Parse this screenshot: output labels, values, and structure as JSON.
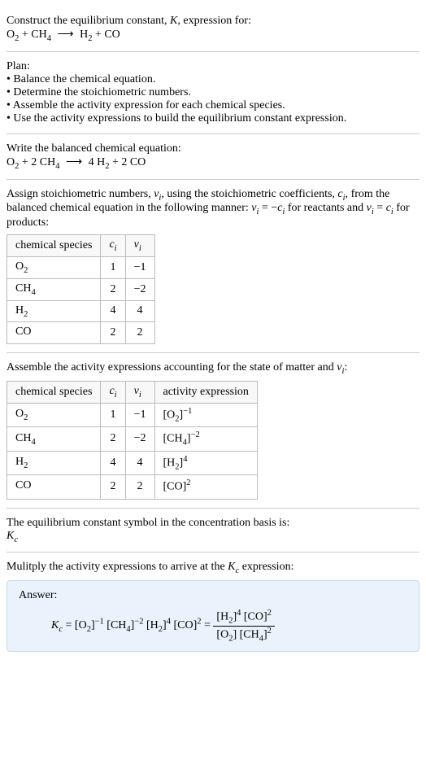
{
  "intro": {
    "title_prefix": "Construct the equilibrium constant, ",
    "title_symbol": "K",
    "title_suffix": ", expression for:",
    "equation_lhs1": "O",
    "equation_lhs1_sub": "2",
    "equation_plus": " + ",
    "equation_lhs2": "CH",
    "equation_lhs2_sub": "4",
    "arrow": "⟶",
    "equation_rhs1": "H",
    "equation_rhs1_sub": "2",
    "equation_rhs2": "CO"
  },
  "plan": {
    "title": "Plan:",
    "items": [
      "Balance the chemical equation.",
      "Determine the stoichiometric numbers.",
      "Assemble the activity expression for each chemical species.",
      "Use the activity expressions to build the equilibrium constant expression."
    ]
  },
  "balanced": {
    "title": "Write the balanced chemical equation:",
    "lhs1": "O",
    "lhs1_sub": "2",
    "plus1": " + 2 ",
    "lhs2": "CH",
    "lhs2_sub": "4",
    "arrow": "⟶",
    "rhs1_coef": " 4 ",
    "rhs1": "H",
    "rhs1_sub": "2",
    "plus2": " + 2 ",
    "rhs2": "CO"
  },
  "stoich": {
    "intro_prefix": "Assign stoichiometric numbers, ",
    "nu": "ν",
    "nu_sub": "i",
    "intro_mid1": ", using the stoichiometric coefficients, ",
    "ci": "c",
    "ci_sub": "i",
    "intro_mid2": ", from the balanced chemical equation in the following manner: ",
    "rel1": "ν",
    "rel1_sub": "i",
    "rel_eq": " = −",
    "rel1c": "c",
    "rel1c_sub": "i",
    "intro_mid3": " for reactants and ",
    "rel2": "ν",
    "rel2_sub": "i",
    "rel2_eq": " = ",
    "rel2c": "c",
    "rel2c_sub": "i",
    "intro_end": " for products:",
    "table": {
      "headers": {
        "species": "chemical species",
        "ci": "c",
        "ci_sub": "i",
        "nu": "ν",
        "nu_sub": "i"
      },
      "rows": [
        {
          "species": "O",
          "species_sub": "2",
          "ci": "1",
          "nu": "−1"
        },
        {
          "species": "CH",
          "species_sub": "4",
          "ci": "2",
          "nu": "−2"
        },
        {
          "species": "H",
          "species_sub": "2",
          "ci": "4",
          "nu": "4"
        },
        {
          "species": "CO",
          "species_sub": "",
          "ci": "2",
          "nu": "2"
        }
      ]
    }
  },
  "activity": {
    "intro_prefix": "Assemble the activity expressions accounting for the state of matter and ",
    "nu": "ν",
    "nu_sub": "i",
    "intro_end": ":",
    "table": {
      "headers": {
        "species": "chemical species",
        "ci": "c",
        "ci_sub": "i",
        "nu": "ν",
        "nu_sub": "i",
        "act": "activity expression"
      },
      "rows": [
        {
          "species": "O",
          "species_sub": "2",
          "ci": "1",
          "nu": "−1",
          "act_base": "[O",
          "act_sub": "2",
          "act_close": "]",
          "act_sup": "−1"
        },
        {
          "species": "CH",
          "species_sub": "4",
          "ci": "2",
          "nu": "−2",
          "act_base": "[CH",
          "act_sub": "4",
          "act_close": "]",
          "act_sup": "−2"
        },
        {
          "species": "H",
          "species_sub": "2",
          "ci": "4",
          "nu": "4",
          "act_base": "[H",
          "act_sub": "2",
          "act_close": "]",
          "act_sup": "4"
        },
        {
          "species": "CO",
          "species_sub": "",
          "ci": "2",
          "nu": "2",
          "act_base": "[CO",
          "act_sub": "",
          "act_close": "]",
          "act_sup": "2"
        }
      ]
    }
  },
  "symbol": {
    "intro": "The equilibrium constant symbol in the concentration basis is:",
    "K": "K",
    "K_sub": "c"
  },
  "multiply": {
    "intro_prefix": "Mulitply the activity expressions to arrive at the ",
    "K": "K",
    "K_sub": "c",
    "intro_end": " expression:"
  },
  "answer": {
    "title": "Answer:",
    "Kc": "K",
    "Kc_sub": "c",
    "eq": " = ",
    "t1": "[O",
    "t1_sub": "2",
    "t1_close": "]",
    "t1_sup": "−1",
    "t2": " [CH",
    "t2_sub": "4",
    "t2_close": "]",
    "t2_sup": "−2",
    "t3": " [H",
    "t3_sub": "2",
    "t3_close": "]",
    "t3_sup": "4",
    "t4": " [CO]",
    "t4_sup": "2",
    "eq2": " = ",
    "num_t1": "[H",
    "num_t1_sub": "2",
    "num_t1_close": "]",
    "num_t1_sup": "4",
    "num_t2": " [CO]",
    "num_t2_sup": "2",
    "den_t1": "[O",
    "den_t1_sub": "2",
    "den_t1_close": "] ",
    "den_t2": "[CH",
    "den_t2_sub": "4",
    "den_t2_close": "]",
    "den_t2_sup": "2"
  }
}
